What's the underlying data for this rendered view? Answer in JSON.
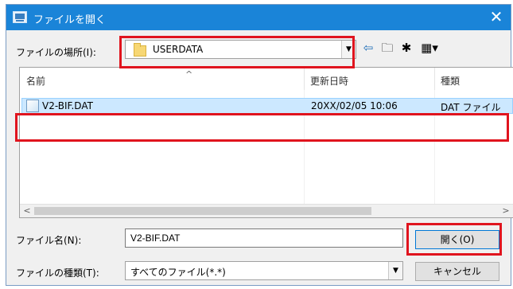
{
  "window": {
    "title": "ファイルを開く",
    "close_glyph": "✕"
  },
  "location": {
    "label": "ファイルの場所(I):",
    "value": "USERDATA"
  },
  "toolbar": {
    "back_glyph": "⇦",
    "up_glyph": "🗀",
    "newfolder_glyph": "✱",
    "view_glyph": "▦▾"
  },
  "list": {
    "columns": [
      "名前",
      "更新日時",
      "種類"
    ],
    "sort_glyph": "^",
    "rows": [
      {
        "name": "V2-BIF.DAT",
        "modified": "20XX/02/05 10:06",
        "type": "DAT ファイル"
      }
    ]
  },
  "filename": {
    "label": "ファイル名(N):",
    "value": "V2-BIF.DAT"
  },
  "filetype": {
    "label": "ファイルの種類(T):",
    "value": "すべてのファイル(*.*)"
  },
  "buttons": {
    "open": "開く(O)",
    "cancel": "キャンセル"
  },
  "highlight_color": "#e0141e"
}
